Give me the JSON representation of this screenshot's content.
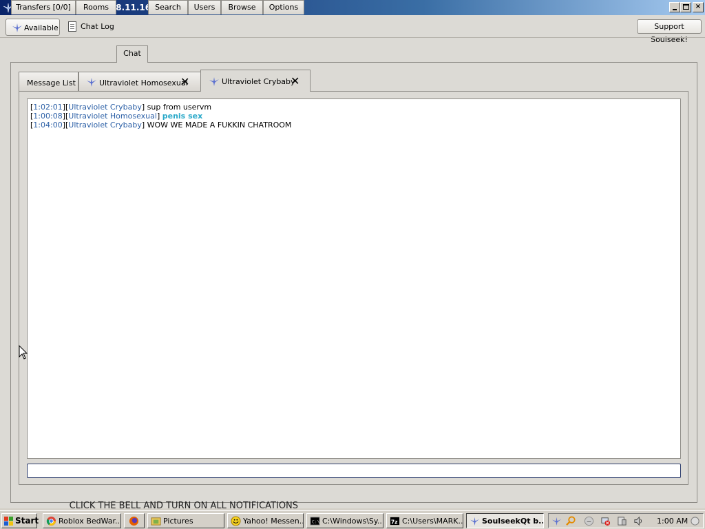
{
  "window": {
    "title": "SoulseekQt build 2018.11.16 [Ultraviolet Homosexual]"
  },
  "toolbar": {
    "status_label": "Available",
    "chatlog_label": "Chat Log",
    "support_label": "Support Soulseek!"
  },
  "tabs": [
    {
      "label": "Transfers [0/0]"
    },
    {
      "label": "Rooms"
    },
    {
      "label": "Chat",
      "active": true
    },
    {
      "label": "Search"
    },
    {
      "label": "Users"
    },
    {
      "label": "Browse"
    },
    {
      "label": "Options"
    }
  ],
  "chat_tabs": [
    {
      "label": "Message List"
    },
    {
      "label": "Ultraviolet Homosexual",
      "closable": true
    },
    {
      "label": "Ultraviolet Crybaby",
      "closable": true,
      "active": true
    }
  ],
  "messages": [
    {
      "time": "1:02:01",
      "user": "Ultraviolet Crybaby",
      "text": "sup from uservm",
      "highlight": false
    },
    {
      "time": "1:00:08",
      "user": "Ultraviolet Homosexual",
      "text": "penis sex",
      "highlight": true
    },
    {
      "time": "1:04:00",
      "user": "Ultraviolet Crybaby",
      "text": "WOW WE MADE A FUKKIN CHATROOM",
      "highlight": false
    }
  ],
  "chat_input": {
    "value": ""
  },
  "banner_text": "_ CLICK THE BELL AND TURN ON ALL NOTIFICATIONS",
  "taskbar": {
    "start_label": "Start",
    "tasks": [
      {
        "label": "Roblox BedWar...",
        "icon": "chrome-icon"
      },
      {
        "label": "",
        "icon": "firefox-icon"
      },
      {
        "label": "Pictures",
        "icon": "folder-icon"
      },
      {
        "label": "Yahoo! Messen...",
        "icon": "yahoo-messenger-icon"
      },
      {
        "label": "C:\\Windows\\Sy...",
        "icon": "console-icon"
      },
      {
        "label": "C:\\Users\\MARK...",
        "icon": "7zip-icon"
      },
      {
        "label": "SoulseekQt b...",
        "icon": "soulseek-icon",
        "active": true
      }
    ],
    "clock": "1:00 AM"
  },
  "colors": {
    "timestamp": "#2b5fa6",
    "highlight": "#2aa9c9",
    "titlebar": "#0a246a"
  }
}
